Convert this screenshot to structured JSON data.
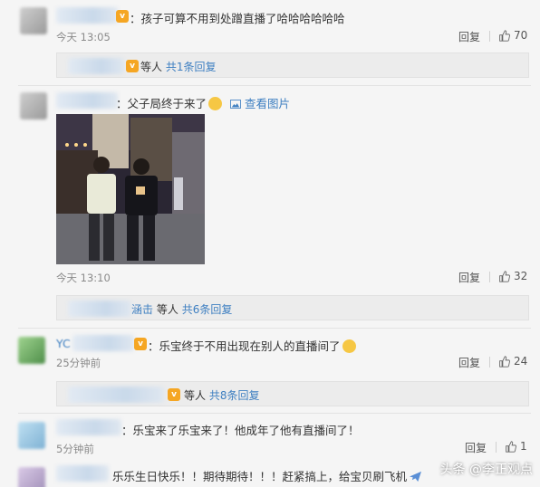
{
  "comments": [
    {
      "text": "：孩子可算不用到处蹭直播了哈哈哈哈哈哈",
      "time": "今天 13:05",
      "reply": "回复",
      "likes": "70",
      "sub": {
        "prefix": "等人",
        "link": "共1条回复"
      }
    },
    {
      "text": "：父子局终于来了",
      "view_image": "查看图片",
      "time": "今天 13:10",
      "reply": "回复",
      "likes": "32",
      "sub": {
        "name_tail": "涵击",
        "prefix": "等人",
        "link": "共6条回复"
      }
    },
    {
      "name_head": "YC",
      "text": "：乐宝终于不用出现在别人的直播间了",
      "time": "25分钟前",
      "reply": "回复",
      "likes": "24",
      "sub": {
        "prefix": "等人",
        "link": "共8条回复"
      }
    },
    {
      "text": "：乐宝来了乐宝来了！他成年了他有直播间了！",
      "time": "5分钟前",
      "reply": "回复",
      "likes": "1"
    },
    {
      "text": "乐乐生日快乐！！期待期待！！！赶紧搞上，给宝贝刷飞机"
    }
  ],
  "watermark": "头条 @李正观点",
  "colors": {
    "link": "#3e7fc1",
    "badge": "#f5a623",
    "background": "#f5f5f5"
  }
}
